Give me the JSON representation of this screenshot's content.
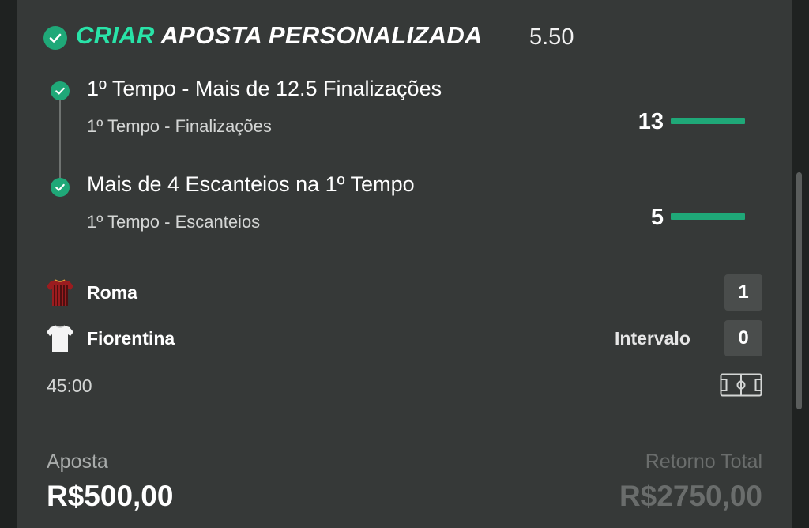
{
  "header": {
    "title_accent": "CRIAR",
    "title_rest": "APOSTA PERSONALIZADA",
    "odds": "5.50"
  },
  "selections": [
    {
      "title": "1º Tempo - Mais de 12.5 Finalizações",
      "subtitle": "1º Tempo - Finalizações",
      "stat_value": "13"
    },
    {
      "title": "Mais de 4 Escanteios na 1º Tempo",
      "subtitle": "1º Tempo - Escanteios",
      "stat_value": "5"
    }
  ],
  "match": {
    "home_team": "Roma",
    "home_score": "1",
    "away_team": "Fiorentina",
    "away_score": "0",
    "status": "Intervalo",
    "clock": "45:00"
  },
  "footer": {
    "stake_label": "Aposta",
    "stake_value": "R$500,00",
    "return_label": "Retorno Total",
    "return_value": "R$2750,00"
  },
  "colors": {
    "accent": "#29e3a8",
    "success": "#1fa878",
    "card_bg": "#363938",
    "home_kit": "#9b1c1f",
    "away_kit": "#f4f4f4"
  },
  "icons": [
    "check-circle-icon",
    "home-jersey-icon",
    "away-jersey-icon",
    "pitch-icon"
  ]
}
